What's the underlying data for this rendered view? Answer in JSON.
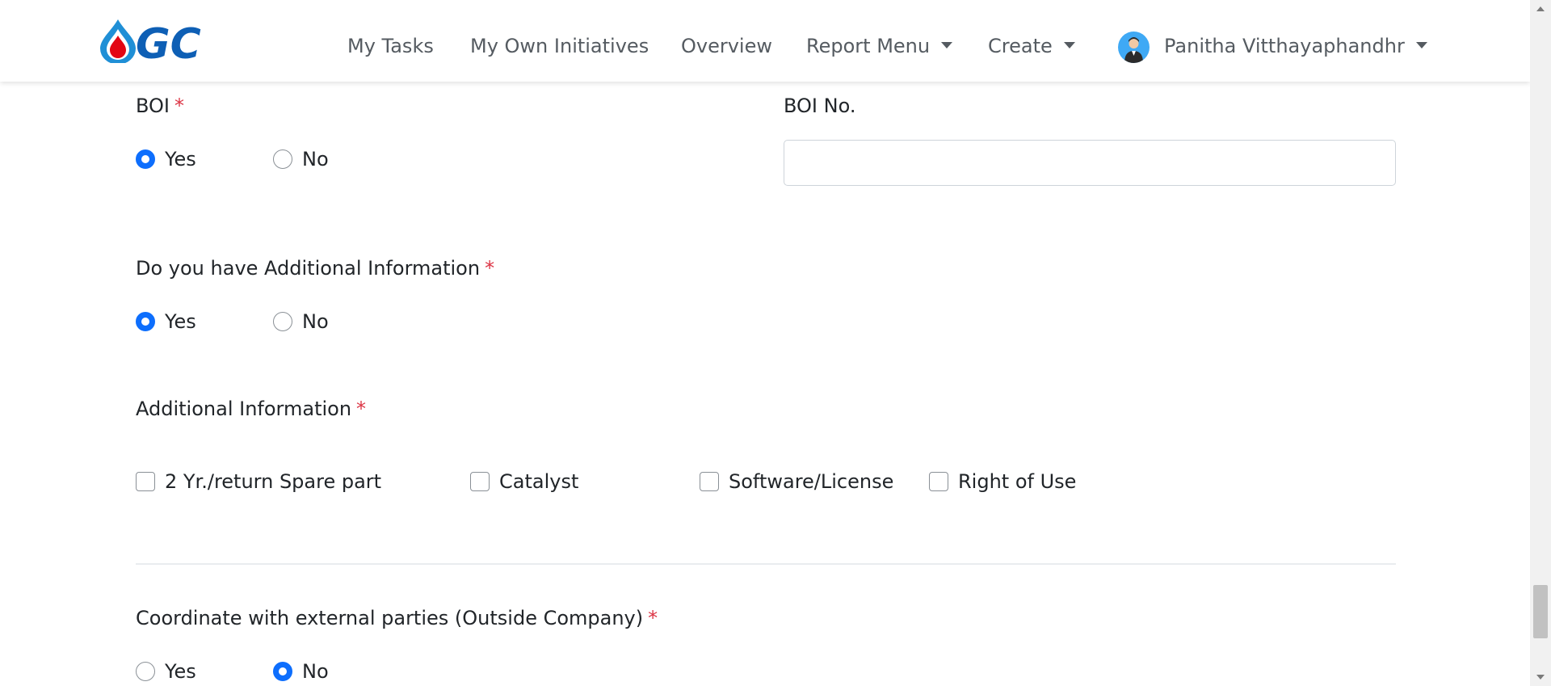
{
  "navbar": {
    "logo_text": "GC",
    "items": [
      {
        "label": "My Tasks"
      },
      {
        "label": "My Own Initiatives"
      },
      {
        "label": "Overview"
      },
      {
        "label": "Report Menu"
      },
      {
        "label": "Create"
      }
    ],
    "user_name": "Panitha Vitthayaphandhr",
    "colors": {
      "brand_blue": "#0e5fb5",
      "drop_red": "#e30613",
      "drop_blue": "#1f8fd6",
      "avatar_bg": "#3fa9f5"
    }
  },
  "form": {
    "required_marker": "*",
    "boi": {
      "label": "BOI",
      "options": [
        {
          "label": "Yes",
          "checked": true
        },
        {
          "label": "No",
          "checked": false
        }
      ]
    },
    "boi_no": {
      "label": "BOI No.",
      "value": "",
      "placeholder": ""
    },
    "additional_info_question": {
      "label": "Do you have Additional Information",
      "options": [
        {
          "label": "Yes",
          "checked": true
        },
        {
          "label": "No",
          "checked": false
        }
      ]
    },
    "additional_info": {
      "label": "Additional Information",
      "options": [
        {
          "label": "2 Yr./return Spare part",
          "checked": false
        },
        {
          "label": "Catalyst",
          "checked": false
        },
        {
          "label": "Software/License",
          "checked": false
        },
        {
          "label": "Right of Use",
          "checked": false
        }
      ]
    },
    "external_parties": {
      "label": "Coordinate with external parties (Outside Company)",
      "options": [
        {
          "label": "Yes",
          "checked": false
        },
        {
          "label": "No",
          "checked": true
        }
      ]
    }
  },
  "colors": {
    "accent": "#0d6efd",
    "required": "#dc3545"
  }
}
